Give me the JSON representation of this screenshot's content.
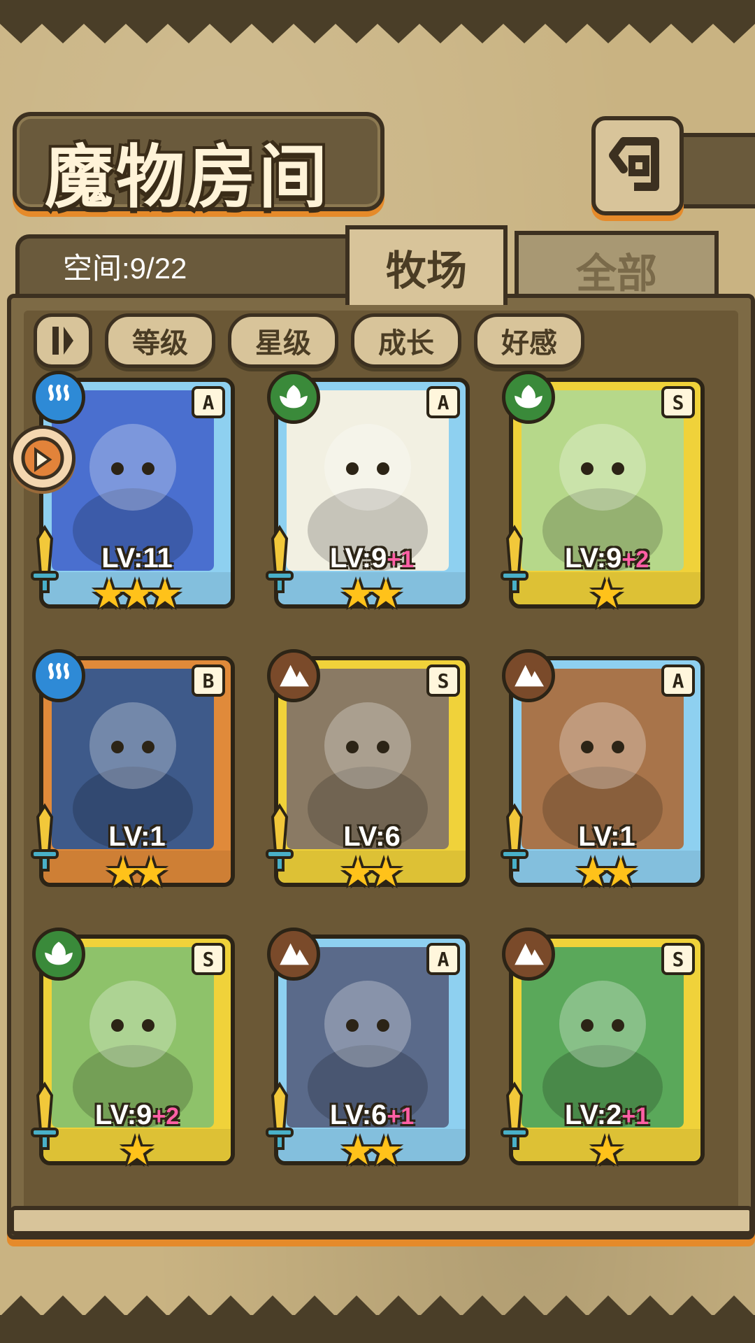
{
  "header": {
    "title": "魔物房间",
    "back_icon": "return-arrow-icon"
  },
  "panel": {
    "space_label": "空间:9/22",
    "tabs": [
      {
        "label": "牧场",
        "active": true
      },
      {
        "label": "全部",
        "active": false
      }
    ],
    "sort_buttons": [
      {
        "label": "等级"
      },
      {
        "label": "星级"
      },
      {
        "label": "成长"
      },
      {
        "label": "好感"
      }
    ]
  },
  "colors": {
    "frame_blue": "#8ed0f0",
    "frame_yellow": "#f0d23a",
    "frame_orange": "#e08a3a",
    "element_water": "#2e8ad6",
    "element_grass": "#3a8a3a",
    "element_earth": "#7a4a2a",
    "level_plus": "#ff5fa5"
  },
  "monsters": [
    {
      "rank": "A",
      "element": "water",
      "level": "LV:11",
      "plus": "",
      "stars": 3,
      "frame": "blue",
      "art": "#4a6fcf"
    },
    {
      "rank": "A",
      "element": "grass",
      "level": "LV:9",
      "plus": "+1",
      "stars": 2,
      "frame": "blue",
      "art": "#f2f0e2"
    },
    {
      "rank": "S",
      "element": "grass",
      "level": "LV:9",
      "plus": "+2",
      "stars": 1,
      "frame": "yellow",
      "art": "#b6d88a"
    },
    {
      "rank": "B",
      "element": "water",
      "level": "LV:1",
      "plus": "",
      "stars": 2,
      "frame": "orange",
      "art": "#3e5a8a"
    },
    {
      "rank": "S",
      "element": "earth",
      "level": "LV:6",
      "plus": "",
      "stars": 2,
      "frame": "yellow",
      "art": "#8a7a64"
    },
    {
      "rank": "A",
      "element": "earth",
      "level": "LV:1",
      "plus": "",
      "stars": 2,
      "frame": "blue",
      "art": "#a8744a"
    },
    {
      "rank": "S",
      "element": "grass",
      "level": "LV:9",
      "plus": "+2",
      "stars": 1,
      "frame": "yellow",
      "art": "#8ec26a"
    },
    {
      "rank": "A",
      "element": "earth",
      "level": "LV:6",
      "plus": "+1",
      "stars": 2,
      "frame": "blue",
      "art": "#5a6a8a"
    },
    {
      "rank": "S",
      "element": "earth",
      "level": "LV:2",
      "plus": "+1",
      "stars": 1,
      "frame": "yellow",
      "art": "#5aa85a"
    }
  ]
}
